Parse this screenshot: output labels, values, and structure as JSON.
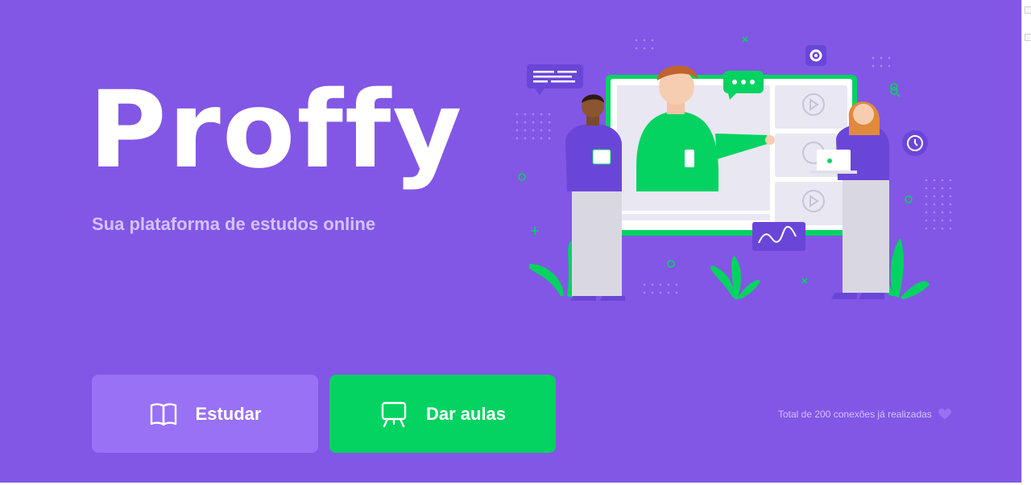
{
  "brand": {
    "logo_text": "Proffy",
    "tagline": "Sua plataforma de estudos online"
  },
  "actions": {
    "study_label": "Estudar",
    "teach_label": "Dar aulas"
  },
  "connections": {
    "text": "Total de 200 conexões já realizadas"
  },
  "colors": {
    "background": "#8257E5",
    "study_button": "#9871F5",
    "teach_button": "#04D361",
    "tagline": "#D4C2FF"
  },
  "icons": {
    "study": "book-open-icon",
    "teach": "presentation-board-icon",
    "connections": "purple-heart-icon",
    "hero": "online-class-illustration"
  }
}
